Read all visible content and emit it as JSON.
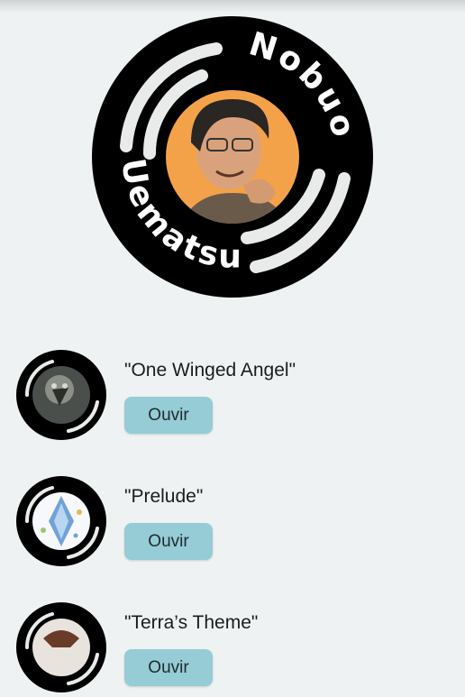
{
  "hero": {
    "arc_text": "Nobuo Uematsu",
    "photo_icon": "nobuo-uematsu-portrait"
  },
  "tracks": [
    {
      "title": "\"One Winged Angel\"",
      "button_label": "Ouvir",
      "cover_icon": "sephiroth-artwork"
    },
    {
      "title": "\"Prelude\"",
      "button_label": "Ouvir",
      "cover_icon": "crystal-artwork"
    },
    {
      "title": "\"Terra’s Theme\"",
      "button_label": "Ouvir",
      "cover_icon": "terra-artwork"
    }
  ],
  "colors": {
    "background": "#eff2f2",
    "disc": "#000000",
    "groove": "#e9ebeb",
    "button": "#95ccd6",
    "photo_backdrop": "#f4a24a"
  }
}
